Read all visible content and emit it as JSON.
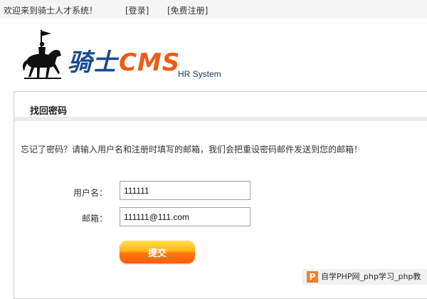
{
  "topbar": {
    "welcome": "欢迎来到骑士人才系统！",
    "login_link": "[登录]",
    "register_link": "[免费注册]"
  },
  "header": {
    "brand_cn": "骑士",
    "brand_cms": "CMS",
    "subtitle": "HR System",
    "logo_icon": "knight-on-horse-icon"
  },
  "panel": {
    "title": "找回密码",
    "hint": "忘记了密码？请输入用户名和注册时填写的邮箱，我们会把重设密码邮件发送到您的邮箱！"
  },
  "form": {
    "username_label": "用户名：",
    "username_value": "111111",
    "email_label": "邮箱：",
    "email_value": "111111@111.com",
    "submit_label": "提交"
  },
  "watermark": {
    "icon_letter": "P",
    "text": "自学PHP网_php学习_php教"
  },
  "colors": {
    "link": "#1f5fa8",
    "brand_blue": "#1a4b94",
    "brand_orange": "#f05a14",
    "button_orange": "#ff7a10"
  }
}
